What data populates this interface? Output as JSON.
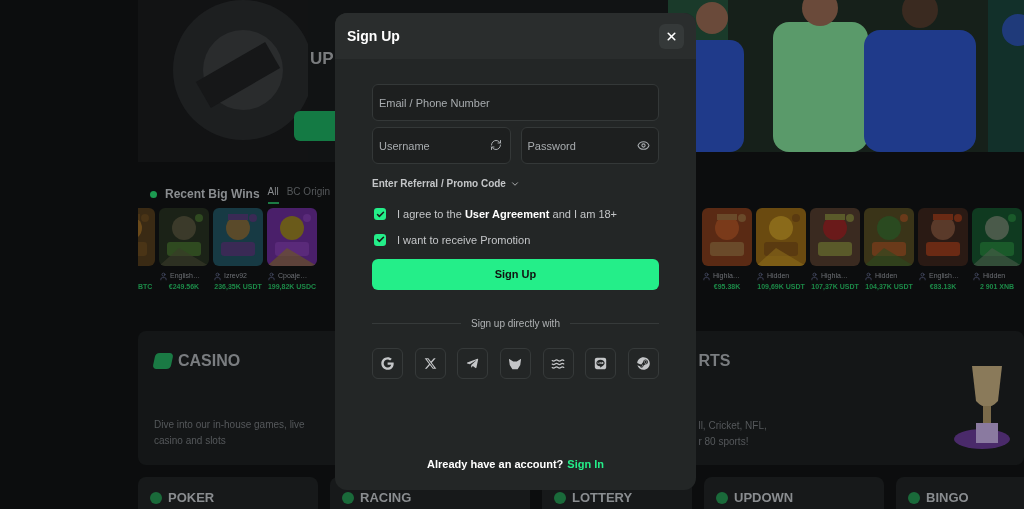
{
  "background": {
    "banner": {
      "heading": "UP"
    },
    "recent_wins": {
      "title": "Recent Big Wins",
      "tabs": [
        {
          "label": "All",
          "selected": true
        },
        {
          "label": "BC Origin",
          "selected": false
        }
      ]
    },
    "bets_left": [
      {
        "amount": "BTC"
      },
      {
        "player": "English…",
        "amount": "€249.56K"
      },
      {
        "player": "Izrev92",
        "amount": "236,35K USDT"
      },
      {
        "player": "Cpoaje…",
        "amount": "199,82K USDC"
      }
    ],
    "bets_right": [
      {
        "player": "Highla…",
        "amount": "€95.38K"
      },
      {
        "player": "Hidden",
        "amount": "109,69K USDT"
      },
      {
        "player": "Highla…",
        "amount": "107,37K USDT"
      },
      {
        "player": "Hidden",
        "amount": "104,37K USDT"
      },
      {
        "player": "English…",
        "amount": "€83.13K"
      },
      {
        "player": "Hidden",
        "amount": "2 901 XNB"
      }
    ],
    "casino": {
      "title": "CASINO",
      "text": "Dive into our in-house games, live casino and slots"
    },
    "sports": {
      "title": "RTS",
      "lines": [
        "ll, Cricket, NFL,",
        "r 80 sports!"
      ]
    },
    "categories": [
      "POKER",
      "RACING",
      "LOTTERY",
      "UPDOWN",
      "BINGO"
    ]
  },
  "modal": {
    "title": "Sign Up",
    "email": {
      "placeholder": "Email / Phone Number"
    },
    "username": {
      "placeholder": "Username"
    },
    "password": {
      "placeholder": "Password"
    },
    "referral": "Enter Referral / Promo Code",
    "checkboxes": [
      {
        "label": "I agree to the **User Agreement** and I am 18+",
        "checked": true
      },
      {
        "label": "I want to receive Promotion",
        "checked": true
      }
    ],
    "submit": "Sign Up",
    "divider": "Sign up directly with",
    "footer": {
      "text": "Already have an account?",
      "link": "Sign In"
    }
  }
}
